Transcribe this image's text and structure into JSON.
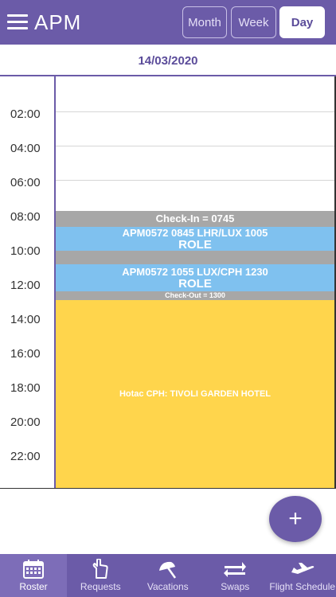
{
  "app": {
    "title": "APM"
  },
  "view_toggle": {
    "month": "Month",
    "week": "Week",
    "day": "Day",
    "selected": "Day"
  },
  "date": "14/03/2020",
  "hours": [
    "02:00",
    "04:00",
    "06:00",
    "08:00",
    "10:00",
    "12:00",
    "14:00",
    "16:00",
    "18:00",
    "20:00",
    "22:00"
  ],
  "events": {
    "checkin": {
      "label": "Check-In = 0745"
    },
    "flight1": {
      "line1": "APM0572 0845 LHR/LUX 1005",
      "line2": "ROLE"
    },
    "flight2": {
      "line1": "APM0572 1055 LUX/CPH 1230",
      "line2": "ROLE"
    },
    "checkout": {
      "label": "Check-Out = 1300"
    },
    "hotel": {
      "label": "Hotac CPH: TIVOLI GARDEN HOTEL"
    }
  },
  "colors": {
    "primary": "#6b5ba8",
    "duty_gray": "#a7a7a7",
    "flight_blue": "#7fc1ef",
    "hotel_yellow": "#ffd54c"
  },
  "fab": {
    "icon": "plus-icon",
    "label": "+"
  },
  "tabs": [
    {
      "label": "Roster",
      "icon": "calendar-icon",
      "active": true
    },
    {
      "label": "Requests",
      "icon": "hand-icon",
      "active": false
    },
    {
      "label": "Vacations",
      "icon": "umbrella-icon",
      "active": false
    },
    {
      "label": "Swaps",
      "icon": "swap-arrows-icon",
      "active": false
    },
    {
      "label": "Flight Schedule",
      "icon": "airplane-icon",
      "active": false
    }
  ]
}
